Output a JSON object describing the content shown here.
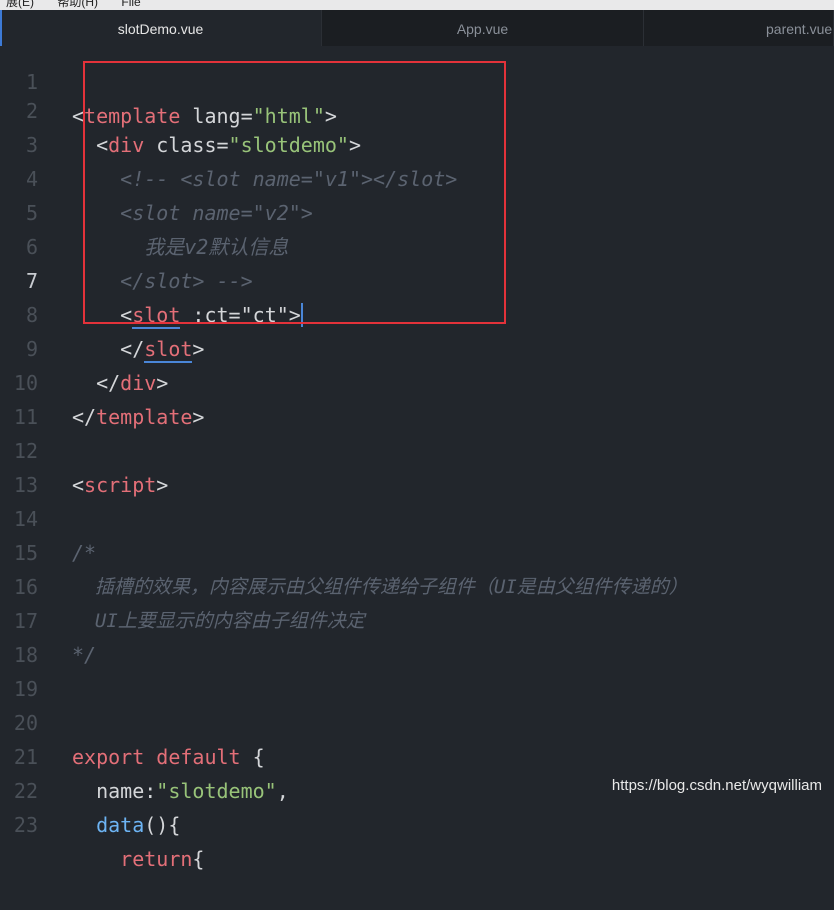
{
  "menubar": {
    "items": [
      "展(E)",
      "帮助(H)",
      "File"
    ]
  },
  "tabs": [
    {
      "label": "slotDemo.vue",
      "active": true
    },
    {
      "label": "App.vue",
      "active": false
    },
    {
      "label": "parent.vue",
      "active": false
    }
  ],
  "editor": {
    "line_numbers": [
      "1",
      "2",
      "3",
      "4",
      "5",
      "6",
      "7",
      "8",
      "9",
      "10",
      "11",
      "12",
      "13",
      "14",
      "15",
      "16",
      "17",
      "18",
      "19",
      "20",
      "21",
      "22",
      "23"
    ],
    "lines": {
      "l1": [
        "<",
        "template",
        " lang=",
        "\"html\"",
        ">"
      ],
      "l2": [
        "  <",
        "div",
        " class=",
        "\"slotdemo\"",
        ">"
      ],
      "l3": "    <!-- <slot name=\"v1\"></slot>",
      "l4": "    <slot name=\"v2\">",
      "l5": "      我是v2默认信息",
      "l6": "    </slot> -->",
      "l7": [
        "    <",
        "slot",
        " :ct=",
        "\"ct\"",
        ">"
      ],
      "l8": [
        "    </",
        "slot",
        ">"
      ],
      "l9": [
        "  </",
        "div",
        ">"
      ],
      "l10": [
        "</",
        "template",
        ">"
      ],
      "l12": [
        "<",
        "script",
        ">"
      ],
      "l14": "/*",
      "l15": "  插槽的效果，内容展示由父组件传递给子组件（UI是由父组件传递的）",
      "l16": "  UI上要显示的内容由子组件决定",
      "l17": "*/",
      "l20": [
        "export",
        " default",
        " {"
      ],
      "l21": [
        "  name:",
        "\"slotdemo\"",
        ","
      ],
      "l22": [
        "  ",
        "data",
        "(){"
      ],
      "l23": [
        "    ",
        "return",
        "{"
      ]
    }
  },
  "watermark": "https://blog.csdn.net/wyqwilliam",
  "colors": {
    "highlight_box": "#e3323a",
    "tag": "#e36f78",
    "string": "#98c379",
    "comment": "#5b6370"
  }
}
